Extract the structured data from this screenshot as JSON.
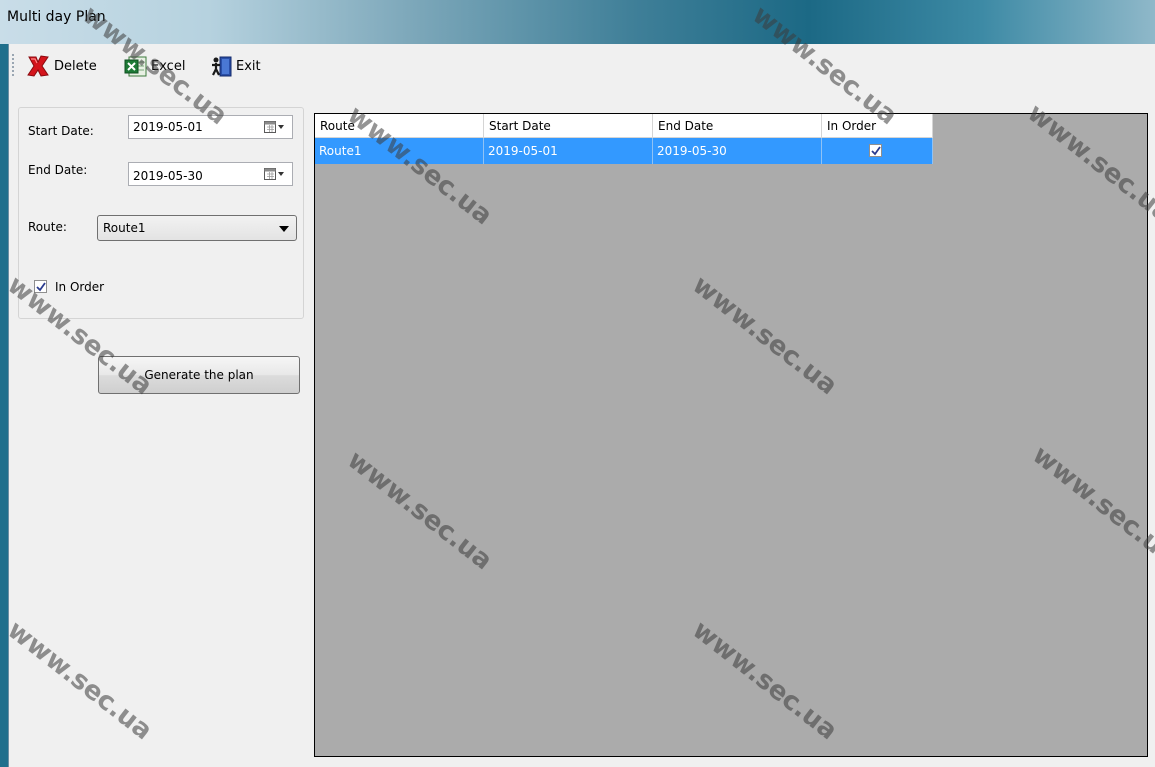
{
  "window": {
    "title": "Multi day Plan"
  },
  "toolbar": {
    "delete_label": "Delete",
    "excel_label": "Excel",
    "exit_label": "Exit"
  },
  "form": {
    "start_date_label": "Start Date:",
    "start_date_value": "2019-05-01",
    "end_date_label": "End Date:",
    "end_date_value": "2019-05-30",
    "route_label": "Route:",
    "route_value": "Route1",
    "in_order_label": "In Order",
    "in_order_checked": true,
    "generate_label": "Generate the plan"
  },
  "grid": {
    "columns": [
      "Route",
      "Start Date",
      "End Date",
      "In Order"
    ],
    "rows": [
      {
        "route": "Route1",
        "start": "2019-05-01",
        "end": "2019-05-30",
        "in_order": true
      }
    ]
  },
  "watermark": "www.sec.ua",
  "colors": {
    "selection": "#3399ff",
    "grid_bg": "#ababab"
  }
}
